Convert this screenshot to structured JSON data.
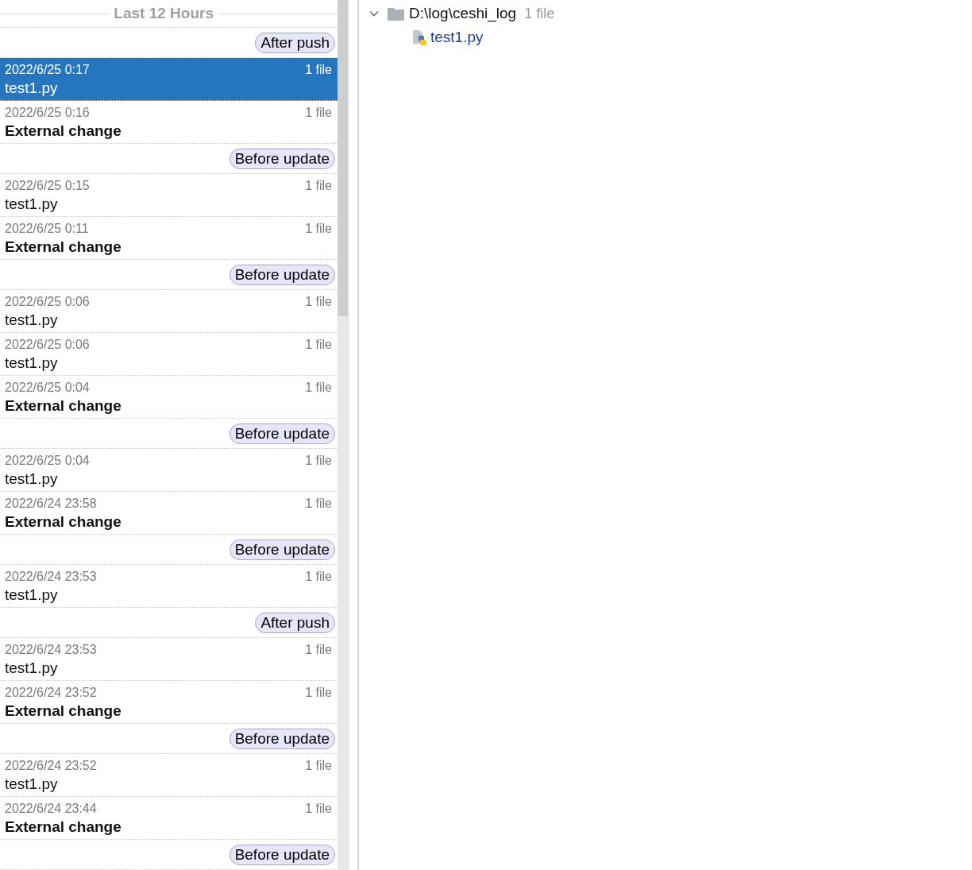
{
  "history": {
    "group_title": "Last 12 Hours",
    "entries": [
      {
        "kind": "label",
        "text": "After push"
      },
      {
        "kind": "revision",
        "time": "2022/6/25 0:17",
        "count": "1 file",
        "title": "test1.py",
        "external": false,
        "selected": true
      },
      {
        "kind": "revision",
        "time": "2022/6/25 0:16",
        "count": "1 file",
        "title": "External change",
        "external": true,
        "selected": false
      },
      {
        "kind": "label",
        "text": "Before update"
      },
      {
        "kind": "revision",
        "time": "2022/6/25 0:15",
        "count": "1 file",
        "title": "test1.py",
        "external": false,
        "selected": false
      },
      {
        "kind": "revision",
        "time": "2022/6/25 0:11",
        "count": "1 file",
        "title": "External change",
        "external": true,
        "selected": false
      },
      {
        "kind": "label",
        "text": "Before update"
      },
      {
        "kind": "revision",
        "time": "2022/6/25 0:06",
        "count": "1 file",
        "title": "test1.py",
        "external": false,
        "selected": false
      },
      {
        "kind": "revision",
        "time": "2022/6/25 0:06",
        "count": "1 file",
        "title": "test1.py",
        "external": false,
        "selected": false
      },
      {
        "kind": "revision",
        "time": "2022/6/25 0:04",
        "count": "1 file",
        "title": "External change",
        "external": true,
        "selected": false
      },
      {
        "kind": "label",
        "text": "Before update"
      },
      {
        "kind": "revision",
        "time": "2022/6/25 0:04",
        "count": "1 file",
        "title": "test1.py",
        "external": false,
        "selected": false
      },
      {
        "kind": "revision",
        "time": "2022/6/24 23:58",
        "count": "1 file",
        "title": "External change",
        "external": true,
        "selected": false
      },
      {
        "kind": "label",
        "text": "Before update"
      },
      {
        "kind": "revision",
        "time": "2022/6/24 23:53",
        "count": "1 file",
        "title": "test1.py",
        "external": false,
        "selected": false
      },
      {
        "kind": "label",
        "text": "After push"
      },
      {
        "kind": "revision",
        "time": "2022/6/24 23:53",
        "count": "1 file",
        "title": "test1.py",
        "external": false,
        "selected": false
      },
      {
        "kind": "revision",
        "time": "2022/6/24 23:52",
        "count": "1 file",
        "title": "External change",
        "external": true,
        "selected": false
      },
      {
        "kind": "label",
        "text": "Before update"
      },
      {
        "kind": "revision",
        "time": "2022/6/24 23:52",
        "count": "1 file",
        "title": "test1.py",
        "external": false,
        "selected": false
      },
      {
        "kind": "revision",
        "time": "2022/6/24 23:44",
        "count": "1 file",
        "title": "External change",
        "external": true,
        "selected": false
      },
      {
        "kind": "label",
        "text": "Before update"
      }
    ]
  },
  "tree": {
    "folder": {
      "name": "D:\\log\\ceshi_log",
      "count": "1 file",
      "expanded": true,
      "children": [
        {
          "name": "test1.py"
        }
      ]
    }
  }
}
